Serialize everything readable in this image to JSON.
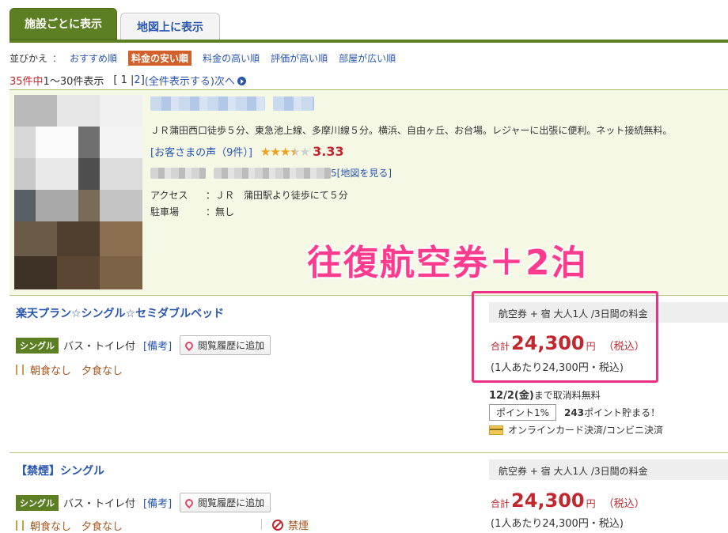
{
  "tabs": [
    {
      "label": "施設ごとに表示",
      "active": true
    },
    {
      "label": "地図上に表示",
      "active": false
    }
  ],
  "sort": {
    "label": "並びかえ",
    "colon": "：",
    "options": [
      "おすすめ順",
      "料金の安い順",
      "料金の高い順",
      "評価が高い順",
      "部屋が広い順"
    ],
    "selected": "料金の安い順"
  },
  "results": {
    "count": "35件中",
    "range": "1〜30件表示",
    "pages_prefix": "[",
    "page1": "1",
    "sep": "|",
    "page2": "2",
    "pages_suffix": "]",
    "show_all": "(全件表示する)",
    "next": "次へ"
  },
  "hotel": {
    "description": "ＪＲ蒲田西口徒歩５分、東急池上線、多摩川線５分。横浜、自由ヶ丘、お台場。レジャーに出張に便利。ネット接続無料。",
    "reviews_link": "[お客さまの声（9件）]",
    "rating": "3.33",
    "stars": 3.5,
    "map_link": "5[地図を見る]",
    "access_label": "アクセス",
    "access_value": "：ＪＲ　蒲田駅より徒歩にて５分",
    "parking_label": "駐車場",
    "parking_value": "：無し"
  },
  "overlay_text": "往復航空券＋2泊",
  "plans": [
    {
      "title": "楽天プラン☆シングル☆セミダブルベッド",
      "room_badge": "シングル",
      "facility": "バス・トイレ付",
      "note": "[備考]",
      "history_button": "閲覧履歴に追加",
      "meals": "朝食なし　夕食なし",
      "price_header": "航空券 + 宿 大人1人 /3日間の料金",
      "total_label": "合計",
      "price": "24,300",
      "yen": "円",
      "tax": "（税込）",
      "per_person": "(1人あたり24,300円・税込)",
      "cancel_date": "12/2(金)",
      "cancel_text": "まで取消料無料",
      "points_badge": "ポイント1%",
      "points_value": "243",
      "points_text": "ポイント貯まる！",
      "payment": "オンラインカード決済/コンビニ決済"
    },
    {
      "title": "【禁煙】シングル",
      "room_badge": "シングル",
      "facility": "バス・トイレ付",
      "note": "[備考]",
      "history_button": "閲覧履歴に追加",
      "meals": "朝食なし　夕食なし",
      "smoking": "禁煙",
      "price_header": "航空券 + 宿 大人1人 /3日間の料金",
      "total_label": "合計",
      "price": "24,300",
      "yen": "円",
      "tax": "（税込）",
      "per_person": "(1人あたり24,300円・税込)"
    }
  ],
  "colors": {
    "accent_green": "#5d7f24",
    "link_blue": "#2a56b0",
    "price_red": "#c1272d",
    "highlight_pink": "#ee2f86",
    "sort_selected": "#d2602a"
  }
}
